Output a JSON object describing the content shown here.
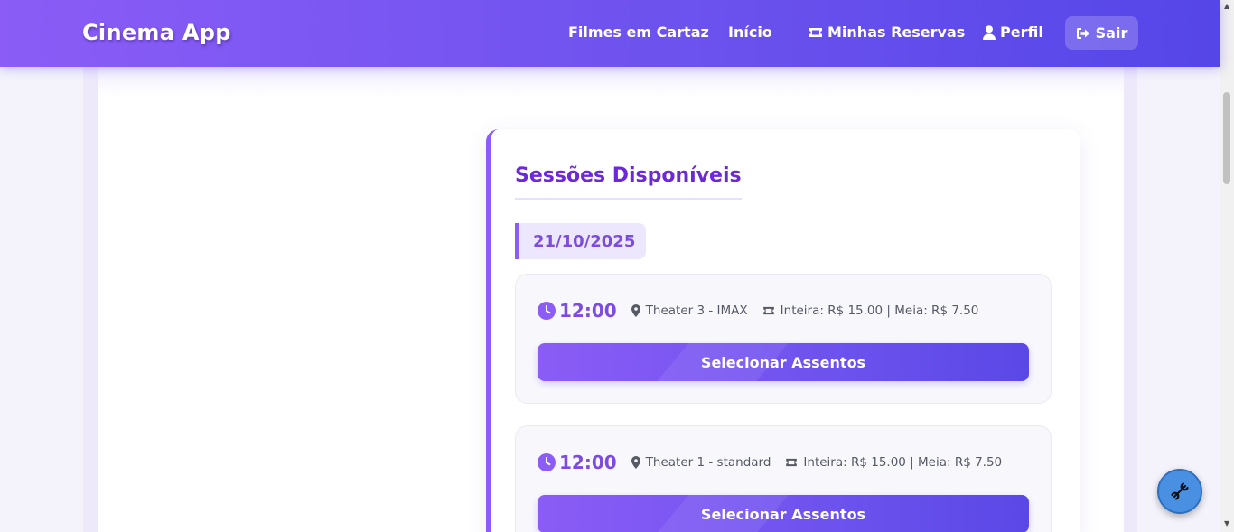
{
  "header": {
    "brand": "Cinema App",
    "nav": {
      "filmes": "Filmes em Cartaz",
      "inicio": "Início",
      "reservas": "Minhas Reservas",
      "perfil": "Perfil",
      "sair": "Sair"
    },
    "icons": {
      "reservas": "ticket-icon",
      "perfil": "user-icon",
      "sair": "sign-out-icon"
    }
  },
  "sessions_panel": {
    "title": "Sessões Disponíveis",
    "date": "21/10/2025",
    "sessions": [
      {
        "time": "12:00",
        "theater": "Theater 3 - IMAX",
        "price": "Inteira: R$ 15.00 | Meia: R$ 7.50",
        "button": "Selecionar Assentos"
      },
      {
        "time": "12:00",
        "theater": "Theater 1 - standard",
        "price": "Inteira: R$ 15.00 | Meia: R$ 7.50",
        "button": "Selecionar Assentos"
      }
    ]
  },
  "floating_button": {
    "icon": "wrench-icon"
  },
  "colors": {
    "primary": "#8b5cf6",
    "primary_dark": "#5546e8",
    "title": "#6d28d9",
    "fab": "#4a90e2"
  }
}
